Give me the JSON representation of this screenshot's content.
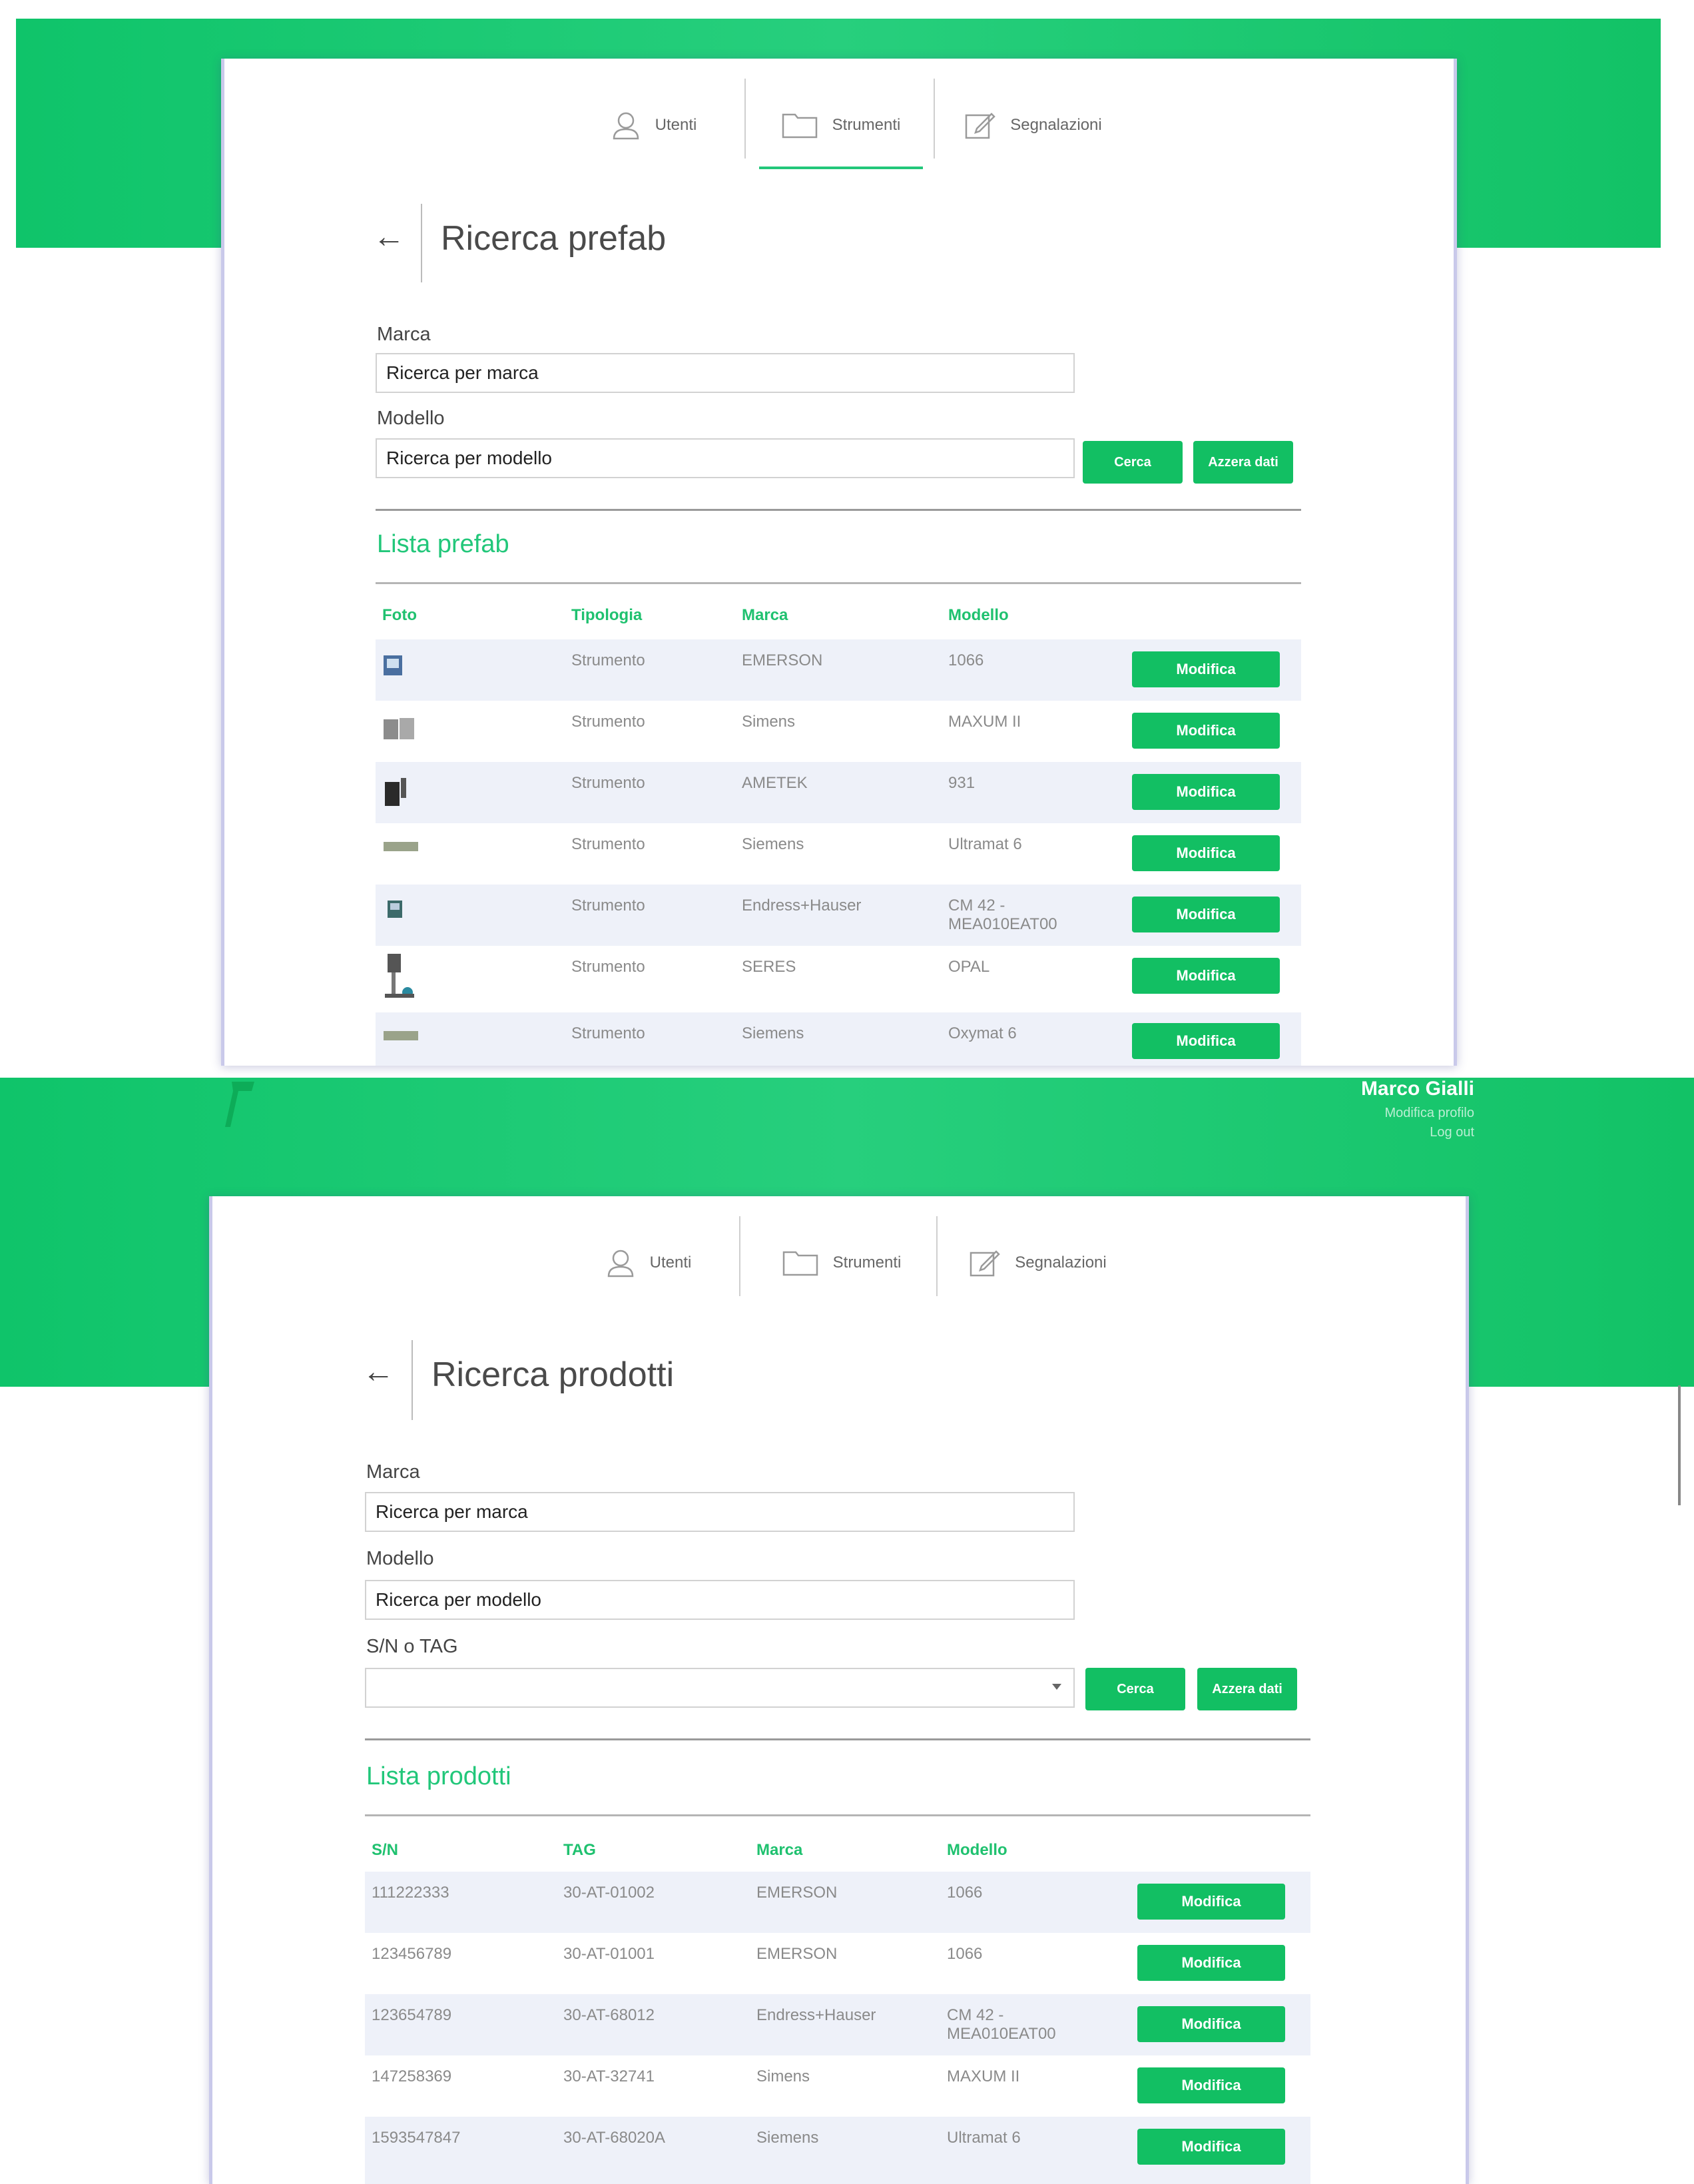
{
  "colors": {
    "accent": "#12bf63",
    "header_band": "#18c66f",
    "row_stripe": "#eef1f9"
  },
  "nav": {
    "tabs": [
      {
        "label": "Utenti",
        "icon": "user-icon"
      },
      {
        "label": "Strumenti",
        "icon": "folder-icon"
      },
      {
        "label": "Segnalazioni",
        "icon": "edit-icon"
      }
    ]
  },
  "prefab": {
    "title": "Ricerca prefab",
    "marca_label": "Marca",
    "marca_placeholder": "Ricerca per marca",
    "modello_label": "Modello",
    "modello_placeholder": "Ricerca per modello",
    "search_button": "Cerca",
    "reset_button": "Azzera dati",
    "list_title": "Lista prefab",
    "columns": [
      "Foto",
      "Tipologia",
      "Marca",
      "Modello"
    ],
    "rows": [
      {
        "tipologia": "Strumento",
        "marca": "EMERSON",
        "modello": "1066",
        "action": "Modifica"
      },
      {
        "tipologia": "Strumento",
        "marca": "Simens",
        "modello": "MAXUM II",
        "action": "Modifica"
      },
      {
        "tipologia": "Strumento",
        "marca": "AMETEK",
        "modello": "931",
        "action": "Modifica"
      },
      {
        "tipologia": "Strumento",
        "marca": "Siemens",
        "modello": "Ultramat 6",
        "action": "Modifica"
      },
      {
        "tipologia": "Strumento",
        "marca": "Endress+Hauser",
        "modello": "CM 42 -\nMEA010EAT00",
        "action": "Modifica"
      },
      {
        "tipologia": "Strumento",
        "marca": "SERES",
        "modello": "OPAL",
        "action": "Modifica"
      },
      {
        "tipologia": "Strumento",
        "marca": "Siemens",
        "modello": "Oxymat 6",
        "action": "Modifica"
      }
    ]
  },
  "user": {
    "name": "Marco Gialli",
    "edit_profile": "Modifica profilo",
    "logout": "Log out"
  },
  "prodotti": {
    "title": "Ricerca prodotti",
    "marca_label": "Marca",
    "marca_placeholder": "Ricerca per marca",
    "modello_label": "Modello",
    "modello_placeholder": "Ricerca per modello",
    "sn_label": "S/N o TAG",
    "search_button": "Cerca",
    "reset_button": "Azzera dati",
    "list_title": "Lista prodotti",
    "columns": [
      "S/N",
      "TAG",
      "Marca",
      "Modello"
    ],
    "rows": [
      {
        "sn": "111222333",
        "tag": "30-AT-01002",
        "marca": "EMERSON",
        "modello": "1066",
        "action": "Modifica"
      },
      {
        "sn": "123456789",
        "tag": "30-AT-01001",
        "marca": "EMERSON",
        "modello": "1066",
        "action": "Modifica"
      },
      {
        "sn": "123654789",
        "tag": "30-AT-68012",
        "marca": "Endress+Hauser",
        "modello": "CM 42 -\nMEA010EAT00",
        "action": "Modifica"
      },
      {
        "sn": "147258369",
        "tag": "30-AT-32741",
        "marca": "Simens",
        "modello": "MAXUM II",
        "action": "Modifica"
      },
      {
        "sn": "1593547847",
        "tag": "30-AT-68020A",
        "marca": "Siemens",
        "modello": "Ultramat 6",
        "action": "Modifica"
      }
    ]
  }
}
